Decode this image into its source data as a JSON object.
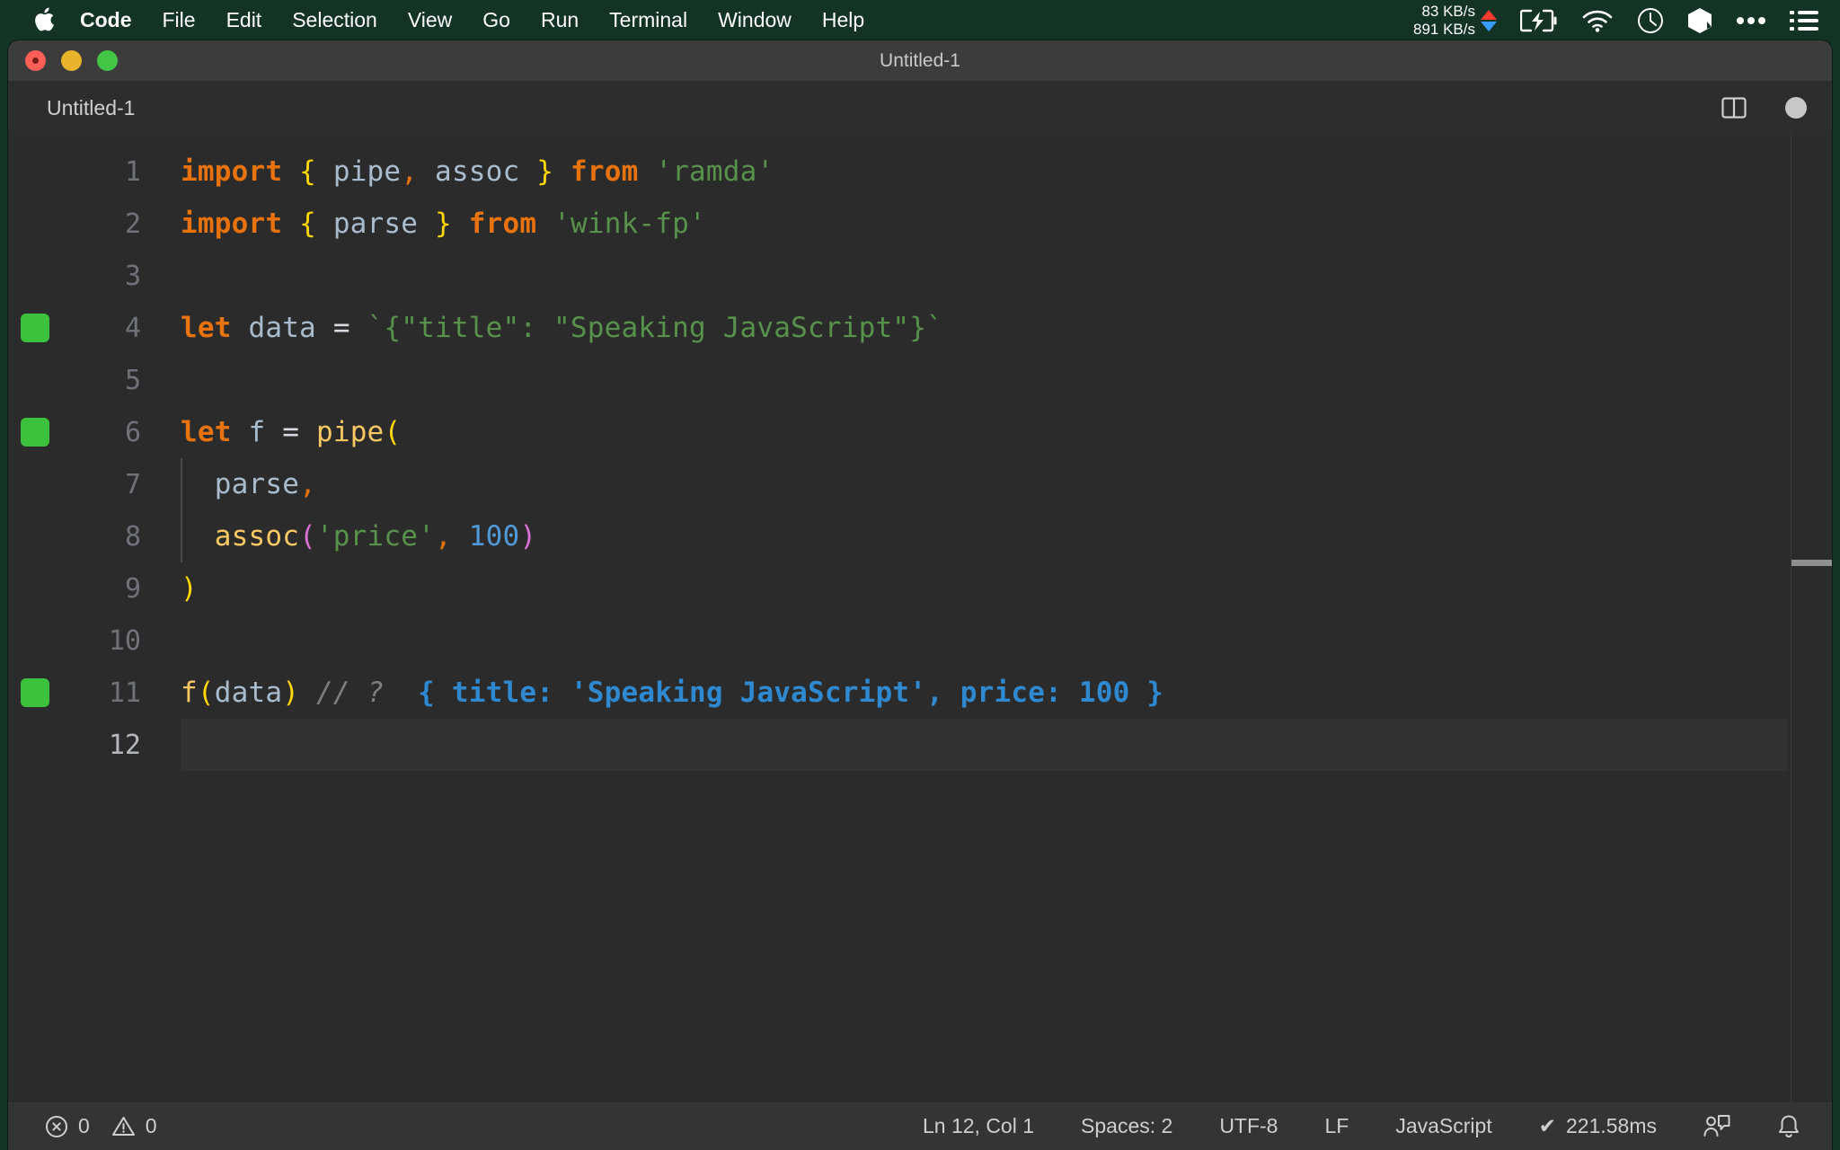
{
  "menubar": {
    "apple_icon": "apple-logo-icon",
    "items": [
      {
        "label": "Code",
        "bold": true
      },
      {
        "label": "File",
        "bold": false
      },
      {
        "label": "Edit",
        "bold": false
      },
      {
        "label": "Selection",
        "bold": false
      },
      {
        "label": "View",
        "bold": false
      },
      {
        "label": "Go",
        "bold": false
      },
      {
        "label": "Run",
        "bold": false
      },
      {
        "label": "Terminal",
        "bold": false
      },
      {
        "label": "Window",
        "bold": false
      },
      {
        "label": "Help",
        "bold": false
      }
    ],
    "network": {
      "upload": "83 KB/s",
      "download": "891 KB/s",
      "upload_color": "#ff3b30",
      "download_color": "#3a9bff"
    },
    "status_icons": [
      "battery-charging-icon",
      "wifi-icon",
      "clock-icon",
      "cube-icon",
      "ellipsis-icon",
      "control-center-list-icon"
    ],
    "background_color": "#133324"
  },
  "window": {
    "title": "Untitled-1",
    "traffic_lights": [
      "close-button",
      "minimize-button",
      "zoom-button"
    ]
  },
  "tabbar": {
    "tabs": [
      {
        "label": "Untitled-1",
        "active": true,
        "dirty": true
      }
    ],
    "actions": [
      "split-editor-icon",
      "unsaved-dot-icon"
    ]
  },
  "editor": {
    "language": "JavaScript",
    "lines": [
      {
        "number": "1",
        "marker": false,
        "indent_guide": false,
        "current": false,
        "tokens": [
          {
            "t": "import",
            "c": "t-kw"
          },
          {
            "t": " ",
            "c": "t-op"
          },
          {
            "t": "{",
            "c": "t-b1"
          },
          {
            "t": " ",
            "c": "t-op"
          },
          {
            "t": "pipe",
            "c": "t-var"
          },
          {
            "t": ",",
            "c": "t-comma"
          },
          {
            "t": " ",
            "c": "t-op"
          },
          {
            "t": "assoc",
            "c": "t-var"
          },
          {
            "t": " ",
            "c": "t-op"
          },
          {
            "t": "}",
            "c": "t-b1"
          },
          {
            "t": " ",
            "c": "t-op"
          },
          {
            "t": "from",
            "c": "t-kw"
          },
          {
            "t": " ",
            "c": "t-op"
          },
          {
            "t": "'ramda'",
            "c": "t-str"
          }
        ]
      },
      {
        "number": "2",
        "marker": false,
        "indent_guide": false,
        "current": false,
        "tokens": [
          {
            "t": "import",
            "c": "t-kw"
          },
          {
            "t": " ",
            "c": "t-op"
          },
          {
            "t": "{",
            "c": "t-b1"
          },
          {
            "t": " ",
            "c": "t-op"
          },
          {
            "t": "parse",
            "c": "t-var"
          },
          {
            "t": " ",
            "c": "t-op"
          },
          {
            "t": "}",
            "c": "t-b1"
          },
          {
            "t": " ",
            "c": "t-op"
          },
          {
            "t": "from",
            "c": "t-kw"
          },
          {
            "t": " ",
            "c": "t-op"
          },
          {
            "t": "'wink-fp'",
            "c": "t-str"
          }
        ]
      },
      {
        "number": "3",
        "marker": false,
        "indent_guide": false,
        "current": false,
        "tokens": []
      },
      {
        "number": "4",
        "marker": true,
        "indent_guide": false,
        "current": false,
        "tokens": [
          {
            "t": "let",
            "c": "t-kw"
          },
          {
            "t": " ",
            "c": "t-op"
          },
          {
            "t": "data",
            "c": "t-var"
          },
          {
            "t": " ",
            "c": "t-op"
          },
          {
            "t": "=",
            "c": "t-op"
          },
          {
            "t": " ",
            "c": "t-op"
          },
          {
            "t": "`{\"title\": \"Speaking JavaScript\"}`",
            "c": "t-str"
          }
        ]
      },
      {
        "number": "5",
        "marker": false,
        "indent_guide": false,
        "current": false,
        "tokens": []
      },
      {
        "number": "6",
        "marker": true,
        "indent_guide": false,
        "current": false,
        "tokens": [
          {
            "t": "let",
            "c": "t-kw"
          },
          {
            "t": " ",
            "c": "t-op"
          },
          {
            "t": "f",
            "c": "t-var"
          },
          {
            "t": " ",
            "c": "t-op"
          },
          {
            "t": "=",
            "c": "t-op"
          },
          {
            "t": " ",
            "c": "t-op"
          },
          {
            "t": "pipe",
            "c": "t-fn"
          },
          {
            "t": "(",
            "c": "t-b1"
          }
        ]
      },
      {
        "number": "7",
        "marker": false,
        "indent_guide": true,
        "current": false,
        "tokens": [
          {
            "t": "  ",
            "c": "t-op"
          },
          {
            "t": "parse",
            "c": "t-var"
          },
          {
            "t": ",",
            "c": "t-comma"
          }
        ]
      },
      {
        "number": "8",
        "marker": false,
        "indent_guide": true,
        "current": false,
        "tokens": [
          {
            "t": "  ",
            "c": "t-op"
          },
          {
            "t": "assoc",
            "c": "t-fn"
          },
          {
            "t": "(",
            "c": "t-b2"
          },
          {
            "t": "'price'",
            "c": "t-str"
          },
          {
            "t": ",",
            "c": "t-comma"
          },
          {
            "t": " ",
            "c": "t-op"
          },
          {
            "t": "100",
            "c": "t-num"
          },
          {
            "t": ")",
            "c": "t-b2"
          }
        ]
      },
      {
        "number": "9",
        "marker": false,
        "indent_guide": false,
        "current": false,
        "tokens": [
          {
            "t": ")",
            "c": "t-b1"
          }
        ]
      },
      {
        "number": "10",
        "marker": false,
        "indent_guide": false,
        "current": false,
        "tokens": []
      },
      {
        "number": "11",
        "marker": true,
        "indent_guide": false,
        "current": false,
        "tokens": [
          {
            "t": "f",
            "c": "t-fn"
          },
          {
            "t": "(",
            "c": "t-b1"
          },
          {
            "t": "data",
            "c": "t-var"
          },
          {
            "t": ")",
            "c": "t-b1"
          },
          {
            "t": " ",
            "c": "t-op"
          },
          {
            "t": "// ?",
            "c": "t-comment"
          },
          {
            "t": "  ",
            "c": "t-op"
          },
          {
            "t": "{ title: 'Speaking JavaScript', price: 100 }",
            "c": "t-quokka"
          }
        ]
      },
      {
        "number": "12",
        "marker": false,
        "indent_guide": false,
        "current": true,
        "tokens": []
      }
    ]
  },
  "statusbar": {
    "errors_icon": "error-circle-icon",
    "errors_count": "0",
    "warnings_icon": "warning-triangle-icon",
    "warnings_count": "0",
    "cursor_position": "Ln 12, Col 1",
    "indentation": "Spaces: 2",
    "encoding": "UTF-8",
    "eol": "LF",
    "language_mode": "JavaScript",
    "quokka_check": "✔",
    "quokka_time": "221.58ms",
    "right_icons": [
      "live-share-icon",
      "notifications-bell-icon"
    ]
  }
}
